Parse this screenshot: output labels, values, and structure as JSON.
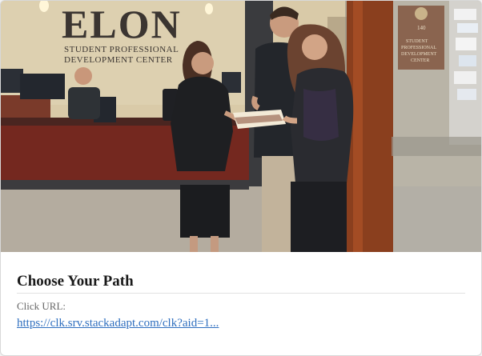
{
  "card": {
    "image": {
      "sign_main": "ELON",
      "sign_line1": "STUDENT PROFESSIONAL",
      "sign_line2": "DEVELOPMENT CENTER",
      "door_sign_number": "140",
      "door_sign_line1": "STUDENT",
      "door_sign_line2": "PROFESSIONAL",
      "door_sign_line3": "DEVELOPMENT",
      "door_sign_line4": "CENTER"
    },
    "title": "Choose Your Path",
    "click_url_label": "Click URL:",
    "click_url": "https://clk.srv.stackadapt.com/clk?aid=1..."
  },
  "colors": {
    "link": "#2f6fbf",
    "title": "#1a1a1a",
    "wall": "#d8c9a6",
    "desk": "#7a2a22",
    "carpet": "#b9b2a6"
  }
}
